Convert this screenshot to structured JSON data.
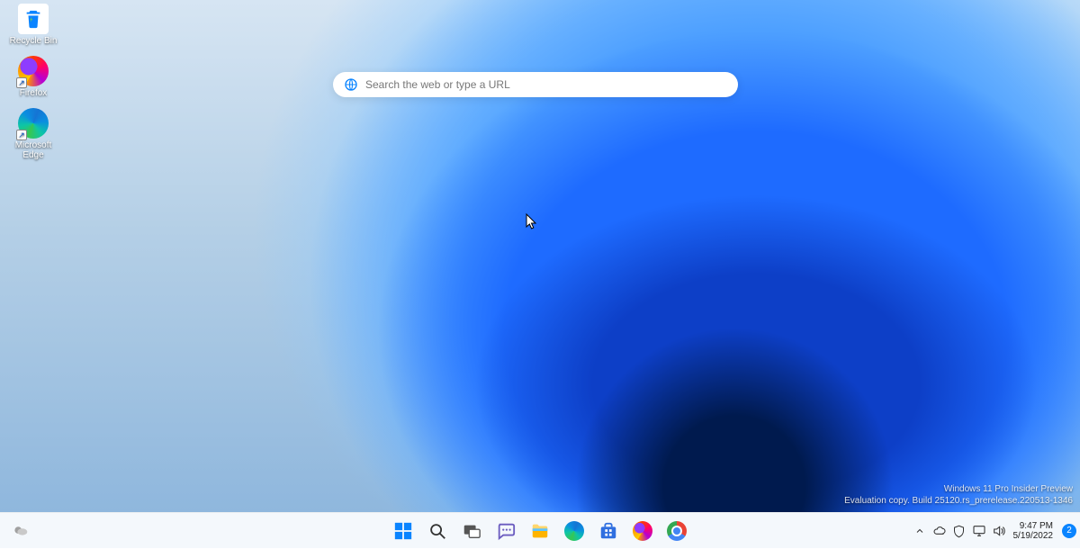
{
  "desktop_icons": {
    "recycle_bin": "Recycle Bin",
    "firefox": "Firefox",
    "edge": "Microsoft Edge"
  },
  "search": {
    "placeholder": "Search the web or type a URL"
  },
  "watermark": {
    "line1": "Windows 11 Pro Insider Preview",
    "line2": "Evaluation copy. Build 25120.rs_prerelease.220513-1346"
  },
  "taskbar": {
    "pinned": [
      {
        "name": "start",
        "label": "Start"
      },
      {
        "name": "search",
        "label": "Search"
      },
      {
        "name": "task-view",
        "label": "Task View"
      },
      {
        "name": "chat",
        "label": "Chat"
      },
      {
        "name": "file-explorer",
        "label": "File Explorer"
      },
      {
        "name": "edge",
        "label": "Microsoft Edge"
      },
      {
        "name": "store",
        "label": "Microsoft Store"
      },
      {
        "name": "firefox",
        "label": "Firefox"
      },
      {
        "name": "chrome",
        "label": "Google Chrome"
      }
    ],
    "tray": {
      "chevron": "Show hidden icons",
      "onedrive": "OneDrive",
      "defender": "Windows Security",
      "network": "Network",
      "volume": "Volume"
    },
    "clock": {
      "time": "9:47 PM",
      "date": "5/19/2022"
    },
    "notifications": "2"
  }
}
